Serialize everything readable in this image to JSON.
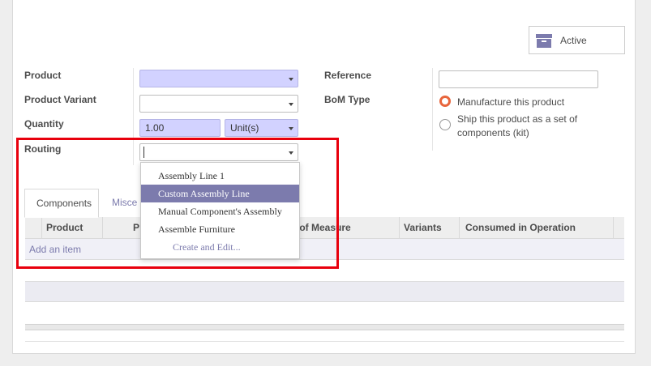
{
  "status_button": {
    "label": "Active",
    "icon": "archive-box-icon"
  },
  "fields": {
    "product": {
      "label": "Product",
      "value": ""
    },
    "product_variant": {
      "label": "Product Variant",
      "value": ""
    },
    "quantity": {
      "label": "Quantity",
      "value": "1.00",
      "uom": "Unit(s)"
    },
    "routing": {
      "label": "Routing",
      "value": ""
    },
    "reference": {
      "label": "Reference",
      "value": ""
    },
    "bom_type": {
      "label": "BoM Type",
      "options": [
        {
          "label": "Manufacture this product",
          "selected": true
        },
        {
          "label_line1": "Ship this product as a set of",
          "label_line2": "components (kit)",
          "selected": false
        }
      ]
    }
  },
  "routing_dropdown": {
    "items": [
      "Assembly Line 1",
      "Custom Assembly Line",
      "Manual Component's Assembly",
      "Assemble Furniture"
    ],
    "highlighted": "Custom Assembly Line",
    "create_edit": "Create and Edit..."
  },
  "tabs": [
    {
      "label": "Components",
      "active": true
    },
    {
      "label": "Misce",
      "active": false
    }
  ],
  "table": {
    "columns": {
      "c1": "Product",
      "c2": "P",
      "c3": "t of Measure",
      "c4": "Variants",
      "c5": "Consumed in Operation"
    },
    "add_item": "Add an item"
  },
  "colors": {
    "accent": "#7c7bad",
    "required_bg": "#d2d2ff",
    "radio_on": "#e8653c",
    "highlight_box": "#e8000d"
  }
}
